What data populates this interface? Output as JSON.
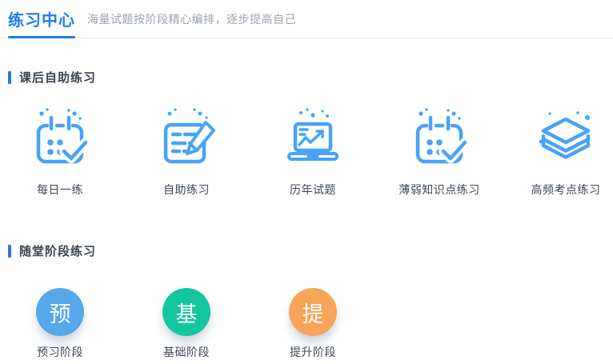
{
  "header": {
    "title": "练习中心",
    "subtitle": "海量试题按阶段精心编排，逐步提高自己"
  },
  "colors": {
    "accent_blue": "#1e7cf2",
    "section_bar_blue": "#2a79d8",
    "icon_blue": "#47a2f9",
    "stage_blue": "#57a8ea",
    "stage_green": "#14c6a0",
    "stage_orange": "#f7a558",
    "text_dark": "#3d4756",
    "text_gray": "#9ba3ae"
  },
  "sections": {
    "self_practice": {
      "heading": "课后自助练习",
      "items": [
        {
          "label": "每日一练",
          "icon": "calendar-check-icon"
        },
        {
          "label": "自助练习",
          "icon": "document-pen-icon"
        },
        {
          "label": "历年试题",
          "icon": "laptop-chart-icon"
        },
        {
          "label": "薄弱知识点练习",
          "icon": "calendar-check-icon"
        },
        {
          "label": "高频考点练习",
          "icon": "layers-icon"
        }
      ]
    },
    "stage_practice": {
      "heading": "随堂阶段练习",
      "items": [
        {
          "label": "预习阶段",
          "badge": "预",
          "color": "#57a8ea"
        },
        {
          "label": "基础阶段",
          "badge": "基",
          "color": "#14c6a0"
        },
        {
          "label": "提升阶段",
          "badge": "提",
          "color": "#f7a558"
        }
      ]
    }
  }
}
